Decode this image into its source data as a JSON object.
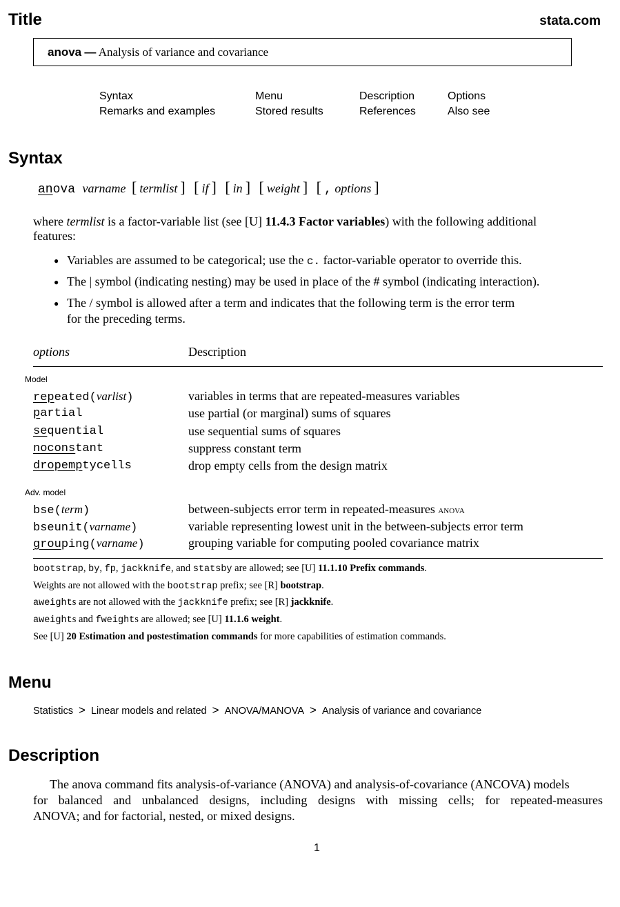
{
  "header": {
    "section_title": "Title",
    "site": "stata.com",
    "command": "anova",
    "dash": "—",
    "subtitle": "Analysis of variance and covariance"
  },
  "nav": {
    "links": [
      "Syntax",
      "Menu",
      "Description",
      "Options",
      "Remarks and examples",
      "Stored results",
      "References",
      "Also see"
    ]
  },
  "syntax": {
    "heading": "Syntax",
    "cmd_underlined": "an",
    "cmd_rest": "ova",
    "varname": "varname",
    "args": [
      "termlist",
      "if",
      "in",
      "weight"
    ],
    "options_prefix": ",",
    "options": "options",
    "where_pre": "where",
    "where_term": "termlist",
    "where_mid": "is a factor-variable list (see",
    "where_ref_manual": "[U]",
    "where_ref": "11.4.3 Factor variables",
    "where_post": ") with the following additional",
    "where_line2": "features:",
    "bullets": [
      {
        "pre": "Variables are assumed to be categorical; use the",
        "code": "c.",
        "post": "factor-variable operator to override this."
      },
      {
        "pre": "The | symbol (indicating nesting) may be used in place of the # symbol (indicating interaction).",
        "code": "",
        "post": ""
      },
      {
        "pre": "The / symbol is allowed after a term and indicates that the following term is the error term",
        "code": "",
        "post": ""
      }
    ],
    "bullet3_line2": "for the preceding terms."
  },
  "options_table": {
    "col_options": "options",
    "col_description": "Description",
    "groups": [
      {
        "label": "Model",
        "rows": [
          {
            "u": "rep",
            "rest": "eated(",
            "arg": "varlist",
            "close": ")",
            "desc": "variables in terms that are repeated-measures variables"
          },
          {
            "u": "p",
            "rest": "artial",
            "arg": "",
            "close": "",
            "desc": "use partial (or marginal) sums of squares"
          },
          {
            "u": "se",
            "rest": "quential",
            "arg": "",
            "close": "",
            "desc": "use sequential sums of squares"
          },
          {
            "u": "nocons",
            "rest": "tant",
            "arg": "",
            "close": "",
            "desc": "suppress constant term"
          },
          {
            "u": "dropemp",
            "rest": "tycells",
            "arg": "",
            "close": "",
            "desc": "drop empty cells from the design matrix"
          }
        ]
      },
      {
        "label": "Adv. model",
        "rows": [
          {
            "u": "",
            "rest": "bse(",
            "arg": "term",
            "close": ")",
            "desc": "between-subjects error term in repeated-measures ANOVA"
          },
          {
            "u": "",
            "rest": "bseunit(",
            "arg": "varname",
            "close": ")",
            "desc": "variable representing lowest unit in the between-subjects error term"
          },
          {
            "u": "grou",
            "rest": "ping(",
            "arg": "varname",
            "close": ")",
            "desc": "grouping variable for computing pooled covariance matrix"
          }
        ]
      }
    ],
    "notes": [
      "bootstrap, by, fp, jackknife, and statsby are allowed; see [U] 11.1.10 Prefix commands.",
      "Weights are not allowed with the bootstrap prefix; see [R] bootstrap.",
      "aweights are not allowed with the jackknife prefix; see [R] jackknife.",
      "aweights and fweights are allowed; see [U] 11.1.6 weight.",
      "See [U] 20 Estimation and postestimation commands for more capabilities of estimation commands."
    ]
  },
  "menu": {
    "heading": "Menu",
    "path": [
      "Statistics",
      "Linear models and related",
      "ANOVA/MANOVA",
      "Analysis of variance and covariance"
    ],
    "separator": ">"
  },
  "description": {
    "heading": "Description",
    "text_pre": "The ",
    "text_cmd": "anova",
    "text_line1": " command fits analysis-of-variance (ANOVA) and analysis-of-covariance (ANCOVA) models",
    "text_line2": "for balanced and unbalanced designs, including designs with missing cells; for repeated-measures",
    "text_line3": "ANOVA; and for factorial, nested, or mixed designs."
  },
  "footer": {
    "page_number": "1"
  }
}
